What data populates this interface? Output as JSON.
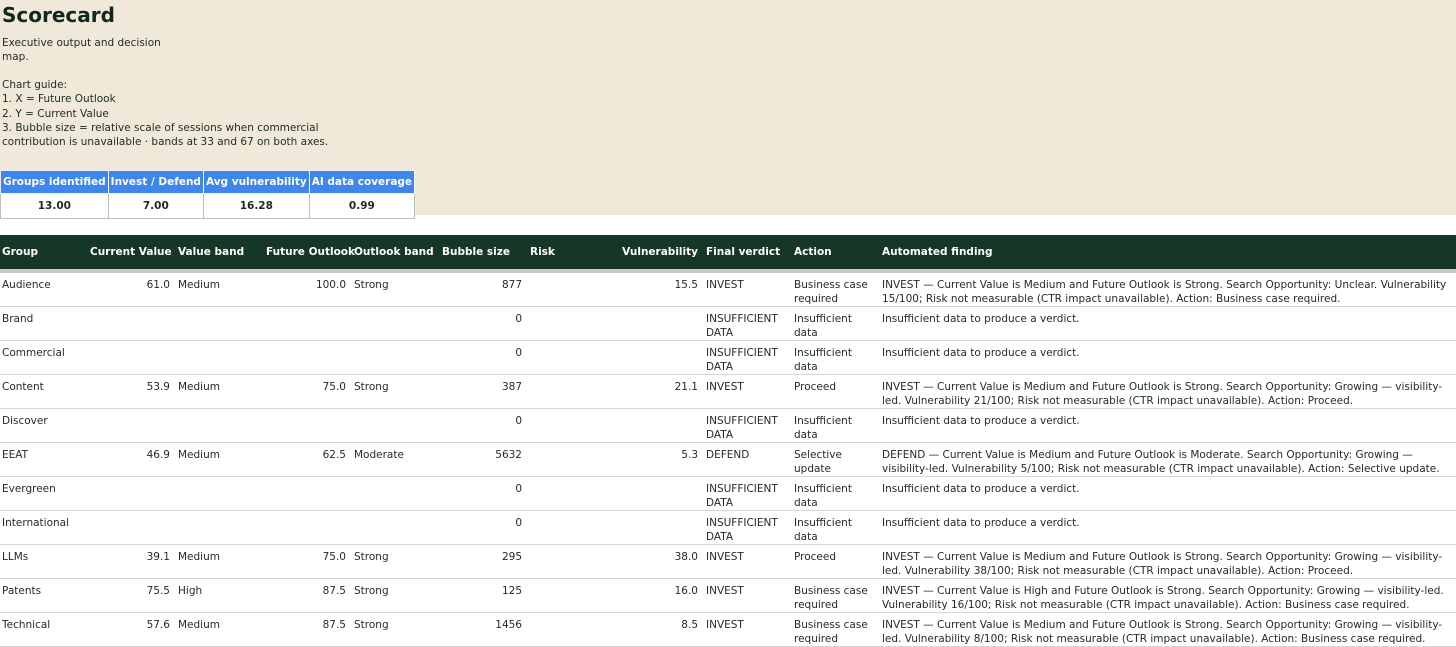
{
  "page": {
    "title": "Scorecard",
    "description": "Executive output and decision map.",
    "guide_title": "Chart guide:",
    "guide_items": [
      "1. X = Future Outlook",
      "2. Y = Current Value",
      "3. Bubble size = relative scale of sessions when commercial contribution is unavailable · bands at 33 and 67 on both axes."
    ]
  },
  "kpis": {
    "headers": [
      "Groups identified",
      "Invest / Defend",
      "Avg vulnerability",
      "AI data coverage"
    ],
    "values": [
      "13.00",
      "7.00",
      "16.28",
      "0.99"
    ]
  },
  "table": {
    "headers": [
      "Group",
      "Current Value",
      "Value band",
      "Future Outlook",
      "Outlook band",
      "Bubble size",
      "Risk",
      "Vulnerability",
      "Final verdict",
      "Action",
      "Automated finding"
    ],
    "rows": [
      {
        "group": "Audience",
        "current_value": "61.0",
        "value_band": "Medium",
        "future_outlook": "100.0",
        "outlook_band": "Strong",
        "bubble_size": "877",
        "risk": "",
        "vulnerability": "15.5",
        "verdict": "INVEST",
        "action": "Business case required",
        "finding": "INVEST — Current Value is Medium and Future Outlook is Strong. Search Opportunity: Unclear. Vulnerability 15/100; Risk not measurable (CTR impact unavailable). Action: Business case required."
      },
      {
        "group": "Brand",
        "current_value": "",
        "value_band": "",
        "future_outlook": "",
        "outlook_band": "",
        "bubble_size": "0",
        "risk": "",
        "vulnerability": "",
        "verdict": "INSUFFICIENT DATA",
        "action": "Insufficient data",
        "finding": "Insufficient data to produce a verdict."
      },
      {
        "group": "Commercial",
        "current_value": "",
        "value_band": "",
        "future_outlook": "",
        "outlook_band": "",
        "bubble_size": "0",
        "risk": "",
        "vulnerability": "",
        "verdict": "INSUFFICIENT DATA",
        "action": "Insufficient data",
        "finding": "Insufficient data to produce a verdict."
      },
      {
        "group": "Content",
        "current_value": "53.9",
        "value_band": "Medium",
        "future_outlook": "75.0",
        "outlook_band": "Strong",
        "bubble_size": "387",
        "risk": "",
        "vulnerability": "21.1",
        "verdict": "INVEST",
        "action": "Proceed",
        "finding": "INVEST — Current Value is Medium and Future Outlook is Strong. Search Opportunity: Growing — visibility-led. Vulnerability 21/100; Risk not measurable (CTR impact unavailable). Action: Proceed."
      },
      {
        "group": "Discover",
        "current_value": "",
        "value_band": "",
        "future_outlook": "",
        "outlook_band": "",
        "bubble_size": "0",
        "risk": "",
        "vulnerability": "",
        "verdict": "INSUFFICIENT DATA",
        "action": "Insufficient data",
        "finding": "Insufficient data to produce a verdict."
      },
      {
        "group": "EEAT",
        "current_value": "46.9",
        "value_band": "Medium",
        "future_outlook": "62.5",
        "outlook_band": "Moderate",
        "bubble_size": "5632",
        "risk": "",
        "vulnerability": "5.3",
        "verdict": "DEFEND",
        "action": "Selective update",
        "finding": "DEFEND — Current Value is Medium and Future Outlook is Moderate. Search Opportunity: Growing — visibility-led. Vulnerability 5/100; Risk not measurable (CTR impact unavailable). Action: Selective update."
      },
      {
        "group": "Evergreen",
        "current_value": "",
        "value_band": "",
        "future_outlook": "",
        "outlook_band": "",
        "bubble_size": "0",
        "risk": "",
        "vulnerability": "",
        "verdict": "INSUFFICIENT DATA",
        "action": "Insufficient data",
        "finding": "Insufficient data to produce a verdict."
      },
      {
        "group": "International",
        "current_value": "",
        "value_band": "",
        "future_outlook": "",
        "outlook_band": "",
        "bubble_size": "0",
        "risk": "",
        "vulnerability": "",
        "verdict": "INSUFFICIENT DATA",
        "action": "Insufficient data",
        "finding": "Insufficient data to produce a verdict."
      },
      {
        "group": "LLMs",
        "current_value": "39.1",
        "value_band": "Medium",
        "future_outlook": "75.0",
        "outlook_band": "Strong",
        "bubble_size": "295",
        "risk": "",
        "vulnerability": "38.0",
        "verdict": "INVEST",
        "action": "Proceed",
        "finding": "INVEST — Current Value is Medium and Future Outlook is Strong. Search Opportunity: Growing — visibility-led. Vulnerability 38/100; Risk not measurable (CTR impact unavailable). Action: Proceed."
      },
      {
        "group": "Patents",
        "current_value": "75.5",
        "value_band": "High",
        "future_outlook": "87.5",
        "outlook_band": "Strong",
        "bubble_size": "125",
        "risk": "",
        "vulnerability": "16.0",
        "verdict": "INVEST",
        "action": "Business case required",
        "finding": "INVEST — Current Value is High and Future Outlook is Strong. Search Opportunity: Growing — visibility-led. Vulnerability 16/100; Risk not measurable (CTR impact unavailable). Action: Business case required."
      },
      {
        "group": "Technical",
        "current_value": "57.6",
        "value_band": "Medium",
        "future_outlook": "87.5",
        "outlook_band": "Strong",
        "bubble_size": "1456",
        "risk": "",
        "vulnerability": "8.5",
        "verdict": "INVEST",
        "action": "Business case required",
        "finding": "INVEST — Current Value is Medium and Future Outlook is Strong. Search Opportunity: Growing — visibility-led. Vulnerability 8/100; Risk not measurable (CTR impact unavailable). Action: Business case required."
      }
    ]
  }
}
